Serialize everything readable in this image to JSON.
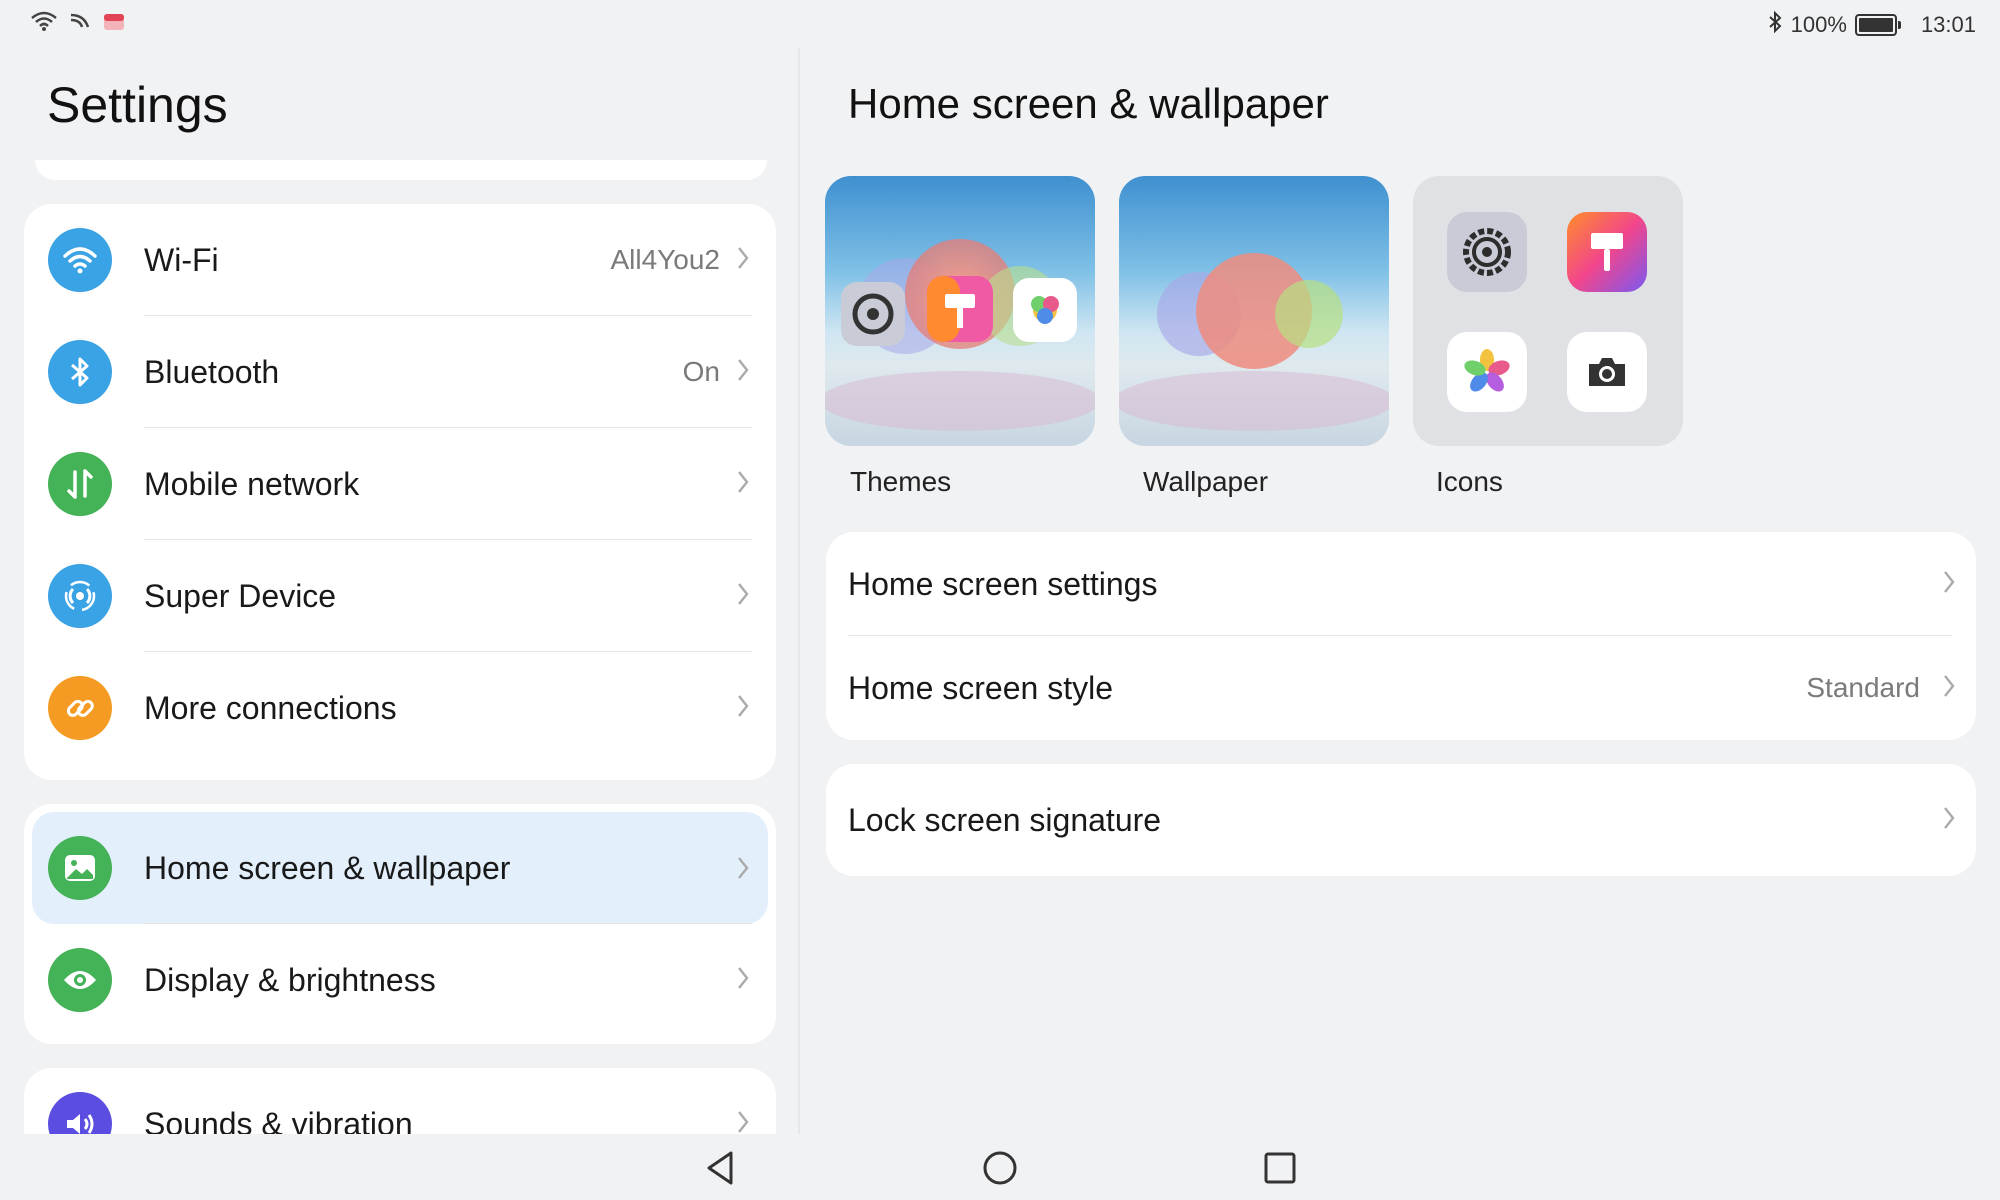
{
  "status_bar": {
    "left_icons": [
      "wifi-icon",
      "signal-icon",
      "notification-app-icon"
    ],
    "battery_percent": "100%",
    "time": "13:01",
    "bluetooth_icon": "bluetooth-icon"
  },
  "sidebar": {
    "title": "Settings",
    "groups": [
      {
        "items": [
          {
            "label": "Wi-Fi",
            "value": "All4You2",
            "icon": "wifi-icon",
            "color": "#3aa3e6"
          },
          {
            "label": "Bluetooth",
            "value": "On",
            "icon": "bluetooth-icon",
            "color": "#3aa3e6"
          },
          {
            "label": "Mobile network",
            "value": "",
            "icon": "mobile-data-icon",
            "color": "#44b257"
          },
          {
            "label": "Super Device",
            "value": "",
            "icon": "super-device-icon",
            "color": "#3aa3e6"
          },
          {
            "label": "More connections",
            "value": "",
            "icon": "link-icon",
            "color": "#f59b23"
          }
        ]
      },
      {
        "items": [
          {
            "label": "Home screen & wallpaper",
            "value": "",
            "icon": "image-icon",
            "color": "#44b257",
            "selected": true
          },
          {
            "label": "Display & brightness",
            "value": "",
            "icon": "eye-icon",
            "color": "#44b257"
          }
        ]
      },
      {
        "items": [
          {
            "label": "Sounds & vibration",
            "value": "",
            "icon": "speaker-icon",
            "color": "#5b4de0"
          }
        ]
      }
    ]
  },
  "detail": {
    "title": "Home screen & wallpaper",
    "tiles": [
      {
        "label": "Themes"
      },
      {
        "label": "Wallpaper"
      },
      {
        "label": "Icons"
      }
    ],
    "settings_card": [
      {
        "label": "Home screen settings",
        "value": ""
      },
      {
        "label": "Home screen style",
        "value": "Standard"
      }
    ],
    "lock_card": [
      {
        "label": "Lock screen signature",
        "value": ""
      }
    ]
  },
  "nav_bar": {
    "back_icon": "back-triangle-icon",
    "home_icon": "home-circle-icon",
    "recents_icon": "recents-square-icon"
  },
  "colors": {
    "background": "#f1f2f4",
    "selected_row": "#e3f0fc",
    "accent_blue": "#3aa3e6"
  }
}
